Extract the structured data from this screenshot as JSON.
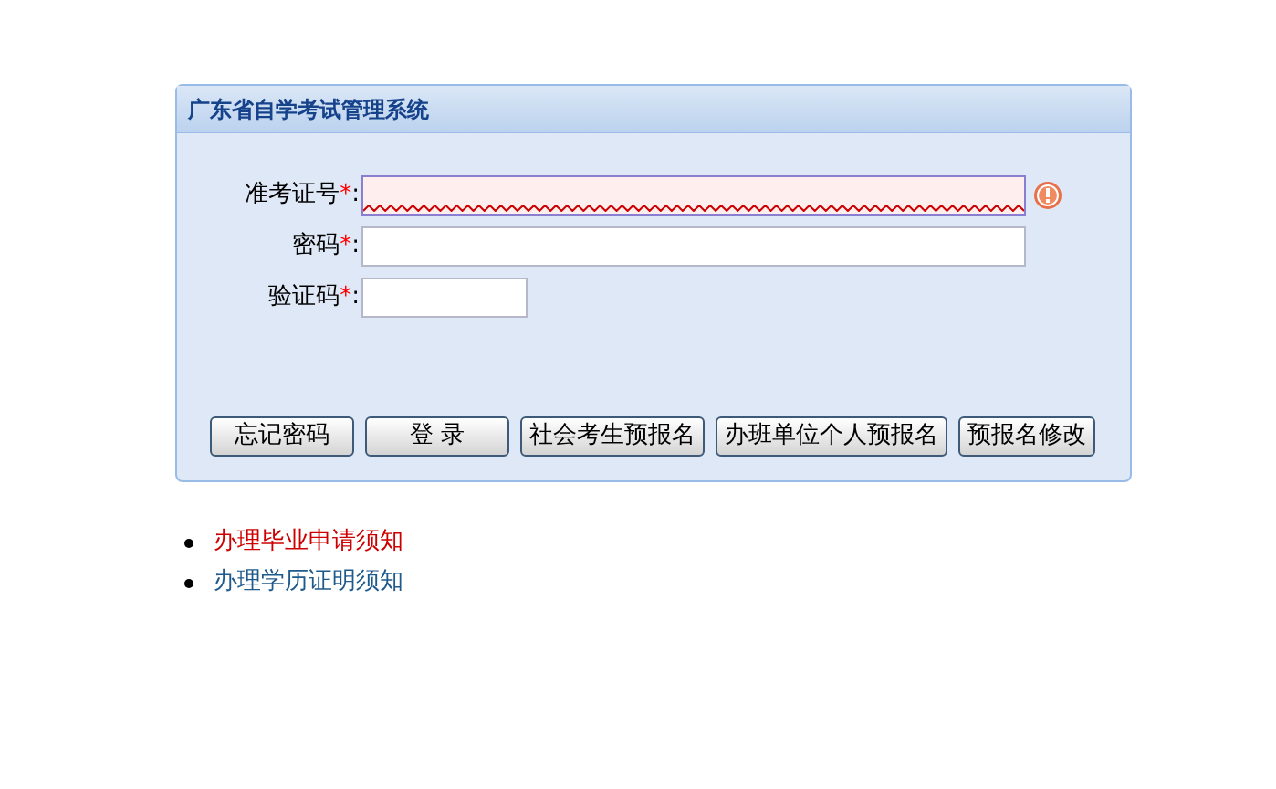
{
  "panel": {
    "title": "广东省自学考试管理系统"
  },
  "fields": [
    {
      "label": "准考证号",
      "required_mark": "*",
      "colon": ":",
      "kind": "wide",
      "error": true
    },
    {
      "label": "密码",
      "required_mark": "*",
      "colon": ":",
      "kind": "wide",
      "error": false
    },
    {
      "label": "验证码",
      "required_mark": "*",
      "colon": ":",
      "kind": "short",
      "error": false
    }
  ],
  "buttons": [
    "忘记密码",
    "登 录",
    "社会考生预报名",
    "办班单位个人预报名",
    "预报名修改"
  ],
  "links": [
    {
      "text": "办理毕业申请须知",
      "color": "#cc0000"
    },
    {
      "text": "办理学历证明须知",
      "color": "#1f5a8c"
    }
  ]
}
